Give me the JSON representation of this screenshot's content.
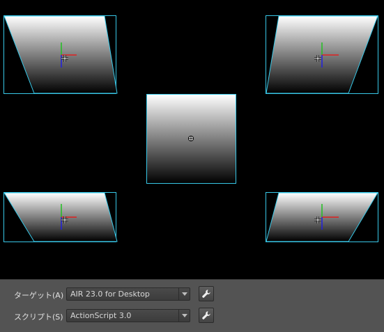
{
  "stage": {
    "background": "#000000",
    "selection_color": "#38c8e8",
    "shape_gradient": [
      "#ffffff",
      "#000000"
    ],
    "symbols": [
      {
        "name": "skewed-symbol-top-left",
        "selected": true
      },
      {
        "name": "skewed-symbol-top-right",
        "selected": true
      },
      {
        "name": "square-symbol-center",
        "selected": true
      },
      {
        "name": "skewed-symbol-bottom-left",
        "selected": true
      },
      {
        "name": "skewed-symbol-bottom-right",
        "selected": true
      }
    ],
    "axis_colors": {
      "x": "#e02020",
      "y": "#20c020",
      "z": "#2020e0"
    }
  },
  "properties": {
    "target": {
      "label": "ターゲット(A) :",
      "value": "AIR 23.0 for Desktop",
      "settings_icon": "wrench-icon"
    },
    "script": {
      "label": "スクリプト(S) :",
      "value": "ActionScript 3.0",
      "settings_icon": "wrench-icon"
    }
  }
}
